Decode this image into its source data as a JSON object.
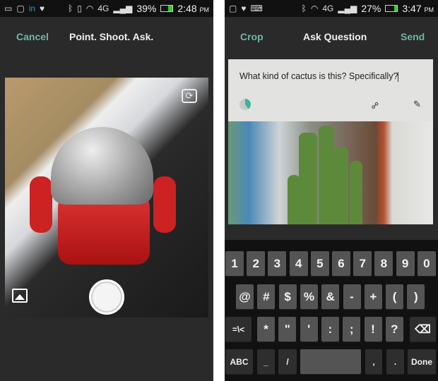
{
  "left": {
    "status": {
      "icons": [
        "message-icon",
        "watch-icon",
        "linkedin-icon",
        "heart-icon",
        "bluetooth-icon",
        "vibrate-icon",
        "wifi-icon",
        "4g-lte-icon",
        "signal-icon",
        "battery-icon"
      ],
      "battery": "39%",
      "time": "2:48",
      "ampm": "PM"
    },
    "header": {
      "cancel": "Cancel",
      "title": "Point. Shoot. Ask."
    }
  },
  "right": {
    "status": {
      "icons": [
        "watch-icon",
        "heart-icon",
        "keyboard-icon",
        "bluetooth-icon",
        "wifi-icon",
        "4g-lte-icon",
        "signal-icon",
        "battery-icon"
      ],
      "battery": "27%",
      "time": "3:47",
      "ampm": "PM"
    },
    "header": {
      "crop": "Crop",
      "title": "Ask Question",
      "send": "Send"
    },
    "question": "What kind of cactus is this? Specifically?",
    "accent": "#6bb8a8",
    "keyboard": {
      "row1": [
        "1",
        "2",
        "3",
        "4",
        "5",
        "6",
        "7",
        "8",
        "9",
        "0"
      ],
      "row2": [
        "@",
        "#",
        "$",
        "%",
        "&",
        "-",
        "+",
        "(",
        ")"
      ],
      "row3": [
        "=\\<",
        "*",
        "\"",
        "'",
        ":",
        ";",
        "!",
        "?"
      ],
      "row4": [
        "ABC",
        "_",
        "/",
        "",
        ",",
        ".",
        "Done"
      ]
    }
  }
}
